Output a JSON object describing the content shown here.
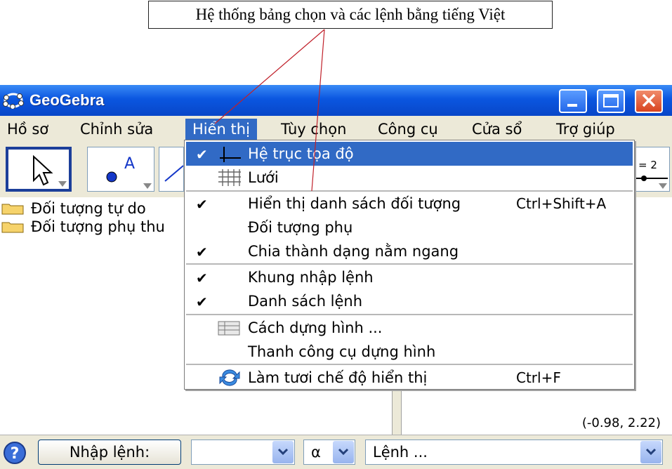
{
  "annotation": {
    "text": "Hệ thống bảng chọn và các lệnh bằng tiếng Việt"
  },
  "window": {
    "title": "GeoGebra",
    "buttons": [
      "minimize",
      "maximize",
      "close"
    ]
  },
  "menubar": {
    "items": [
      {
        "label": "Hồ sơ"
      },
      {
        "label": "Chỉnh sửa"
      },
      {
        "label": "Hiển thị",
        "active": true
      },
      {
        "label": "Tùy chọn"
      },
      {
        "label": "Công cụ"
      },
      {
        "label": "Cửa sổ"
      },
      {
        "label": "Trợ giúp"
      }
    ]
  },
  "toolbar": {
    "right_tool_label": "= 2"
  },
  "algebra": {
    "items": [
      {
        "label": "Đối tượng tự do"
      },
      {
        "label": "Đối tượng phụ thu"
      }
    ]
  },
  "graphics": {
    "coordinates": "(-0.98, 2.22)"
  },
  "dropdown": {
    "items": [
      {
        "label": "Hệ trục tọa độ",
        "checked": true,
        "icon": "axes-icon",
        "highlighted": true
      },
      {
        "label": "Lưới",
        "checked": false,
        "icon": "grid-icon"
      },
      {
        "label": "Hiển thị danh sách đối tượng",
        "checked": true,
        "shortcut": "Ctrl+Shift+A"
      },
      {
        "label": "Đối tượng phụ",
        "checked": false
      },
      {
        "label": "Chia thành dạng nằm ngang",
        "checked": true
      },
      {
        "label": "Khung nhập lệnh",
        "checked": true
      },
      {
        "label": "Danh sách lệnh",
        "checked": true
      },
      {
        "label": "Cách dựng hình ...",
        "checked": false,
        "icon": "table-icon"
      },
      {
        "label": "Thanh công cụ dựng hình",
        "checked": false
      },
      {
        "label": "Làm tươi chế độ hiển thị",
        "checked": false,
        "icon": "refresh-icon",
        "shortcut": "Ctrl+F"
      }
    ],
    "check_glyph": "✔"
  },
  "inputbar": {
    "button_label": "Nhập lệnh:",
    "alpha_value": "α",
    "command_value": "Lệnh ..."
  },
  "colors": {
    "titlebar": "#0b56e0",
    "menu_highlight": "#316ac5",
    "callout_line": "#c0202a"
  }
}
